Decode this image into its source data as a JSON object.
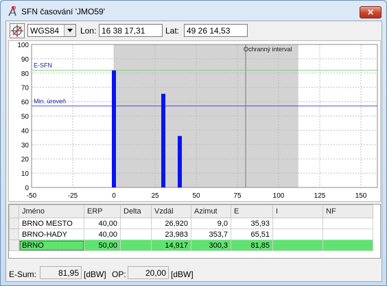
{
  "window": {
    "title": "SFN časování 'JMO59'",
    "close_label": "✕"
  },
  "toolbar": {
    "datum": "WGS84",
    "lon_label": "Lon:",
    "lon_value": "16 38 17,31",
    "lat_label": "Lat:",
    "lat_value": "49 26 14,53"
  },
  "chart_data": {
    "type": "bar",
    "xlim": [
      -50,
      160
    ],
    "ylim": [
      0,
      100
    ],
    "x_ticks": [
      "-50",
      "-25",
      "0",
      "25",
      "50",
      "75",
      "100",
      "125",
      "150"
    ],
    "y_ticks": [
      "0",
      "10",
      "20",
      "30",
      "40",
      "50",
      "60",
      "70",
      "80",
      "90",
      "100"
    ],
    "grid": true,
    "shaded_region": [
      0,
      112
    ],
    "guard_interval": {
      "label": "Ochranný interval",
      "x": 80
    },
    "lines": [
      {
        "label": "E-SFN",
        "y": 81.95,
        "color": "#7ed07e"
      },
      {
        "label": "Min. úroveň",
        "y": 57,
        "color": "#4a4ad6"
      }
    ],
    "bars": [
      {
        "x": 0,
        "value": 81.85
      },
      {
        "x": 30,
        "value": 65.5
      },
      {
        "x": 40,
        "value": 36
      }
    ],
    "bar_color": "#0a14f0"
  },
  "table": {
    "columns": [
      "Jméno",
      "ERP",
      "Delta",
      "Vzdál",
      "Azimut",
      "E",
      "I",
      "NF"
    ],
    "rows": [
      {
        "name": "BRNO MESTO",
        "erp": "40,00",
        "delta": "",
        "vzdal": "26,920",
        "azimut": "9,0",
        "e": "35,93",
        "i": "",
        "nf": "",
        "highlight": false
      },
      {
        "name": "BRNO-HADY",
        "erp": "40,00",
        "delta": "",
        "vzdal": "23,983",
        "azimut": "353,7",
        "e": "65,51",
        "i": "",
        "nf": "",
        "highlight": false
      },
      {
        "name": "BRNO",
        "erp": "50,00",
        "delta": "",
        "vzdal": "14,917",
        "azimut": "300,3",
        "e": "81,85",
        "i": "",
        "nf": "",
        "highlight": true
      }
    ]
  },
  "status": {
    "esum_label": "E-Sum:",
    "esum_value": "81,95",
    "esum_unit": "[dBW]",
    "op_label": "OP:",
    "op_value": "20,00",
    "op_unit": "[dBW]"
  },
  "colors": {
    "highlight_row": "#5fe36f",
    "shade": "#d3d3d3"
  }
}
